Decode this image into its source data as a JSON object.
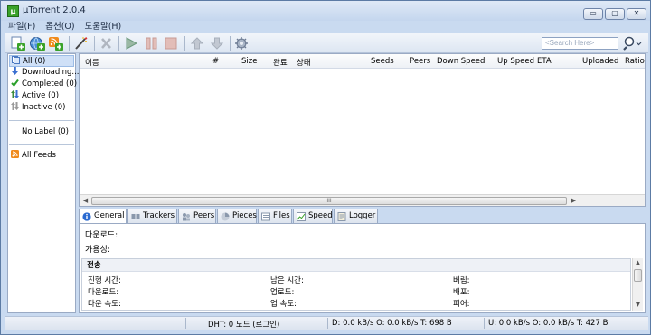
{
  "window": {
    "title": "µTorrent 2.0.4",
    "app_icon": "µ",
    "minimize": "▭",
    "maximize": "▢",
    "close": "✕"
  },
  "menu": [
    "파일(F)",
    "옵션(O)",
    "도움말(H)"
  ],
  "toolbar": {
    "buttons": [
      "add-torrent-icon",
      "add-url-icon",
      "create-torrent-icon",
      "magic-wand-icon",
      "remove-icon",
      "start-icon",
      "pause-icon",
      "stop-icon",
      "move-up-icon",
      "move-down-icon",
      "preferences-icon"
    ],
    "search_placeholder": "<Search Here>"
  },
  "sidebar": {
    "items": [
      {
        "label": "All (0)",
        "icon": "all-icon",
        "color": "#4a78c0"
      },
      {
        "label": "Downloading...",
        "icon": "download-arrow-icon",
        "color": "#3a6fd0"
      },
      {
        "label": "Completed (0)",
        "icon": "checkmark-icon",
        "color": "#2aa02a"
      },
      {
        "label": "Active (0)",
        "icon": "active-arrows-icon",
        "color": "#3a8a3a"
      },
      {
        "label": "Inactive (0)",
        "icon": "inactive-arrows-icon",
        "color": "#888888"
      }
    ],
    "no_label": "No Label (0)",
    "feeds": "All Feeds"
  },
  "list": {
    "columns": [
      "이름",
      "#",
      "Size",
      "완료",
      "상태",
      "Seeds",
      "Peers",
      "Down Speed",
      "Up Speed",
      "ETA",
      "Uploaded",
      "Ratio"
    ],
    "scroll_grip": "III"
  },
  "tabs": [
    "General",
    "Trackers",
    "Peers",
    "Pieces",
    "Files",
    "Speed",
    "Logger"
  ],
  "general": {
    "downloaded_label": "다운로드:",
    "availability_label": "가용성:",
    "transfer_title": "전송",
    "fields": [
      [
        "진행 시간:",
        "남은 시간:",
        "버림:"
      ],
      [
        "다운로드:",
        "업로드:",
        "배포:"
      ],
      [
        "다운 속도:",
        "업 속도:",
        "피어:"
      ]
    ]
  },
  "status": {
    "dht": "DHT: 0 노드  (로그인)",
    "down": "D: 0.0 kB/s O: 0.0 kB/s T: 698 B",
    "up": "U: 0.0 kB/s O: 0.0 kB/s T: 427 B"
  }
}
